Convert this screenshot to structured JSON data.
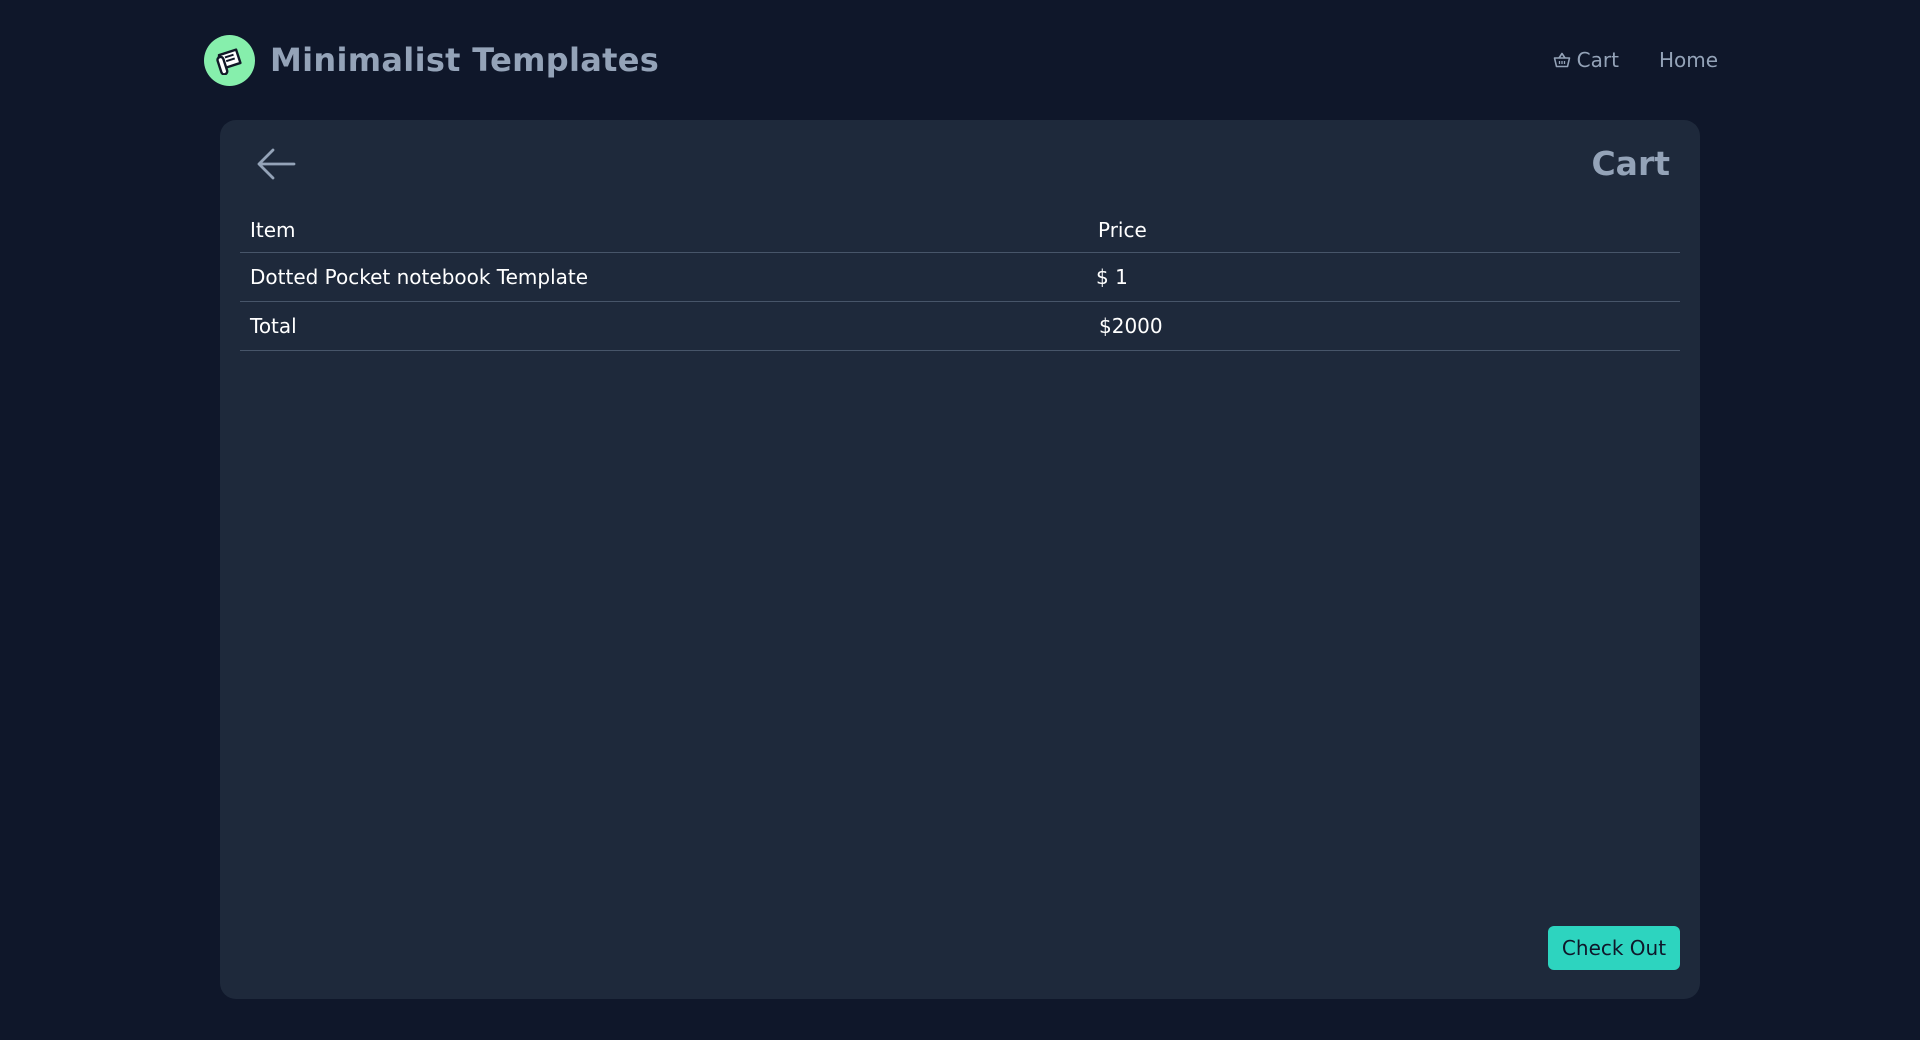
{
  "header": {
    "brand_name": "Minimalist Templates",
    "nav": {
      "cart_label": "Cart",
      "home_label": "Home"
    }
  },
  "card": {
    "title": "Cart",
    "table": {
      "headers": [
        "Item",
        "Price"
      ],
      "rows": [
        {
          "item": "Dotted Pocket notebook Template",
          "price": "$ 1"
        }
      ],
      "total_label": "Total",
      "total_value": "$2000"
    },
    "checkout_label": "Check Out"
  },
  "icons": {
    "logo": "scroll-icon",
    "back": "arrow-left-icon",
    "cart": "basket-icon"
  },
  "colors": {
    "page_bg": "#0f172a",
    "card_bg": "#1e293b",
    "muted_text": "#94a3b8",
    "logo_bg": "#86efac",
    "accent": "#2dd4bf"
  }
}
